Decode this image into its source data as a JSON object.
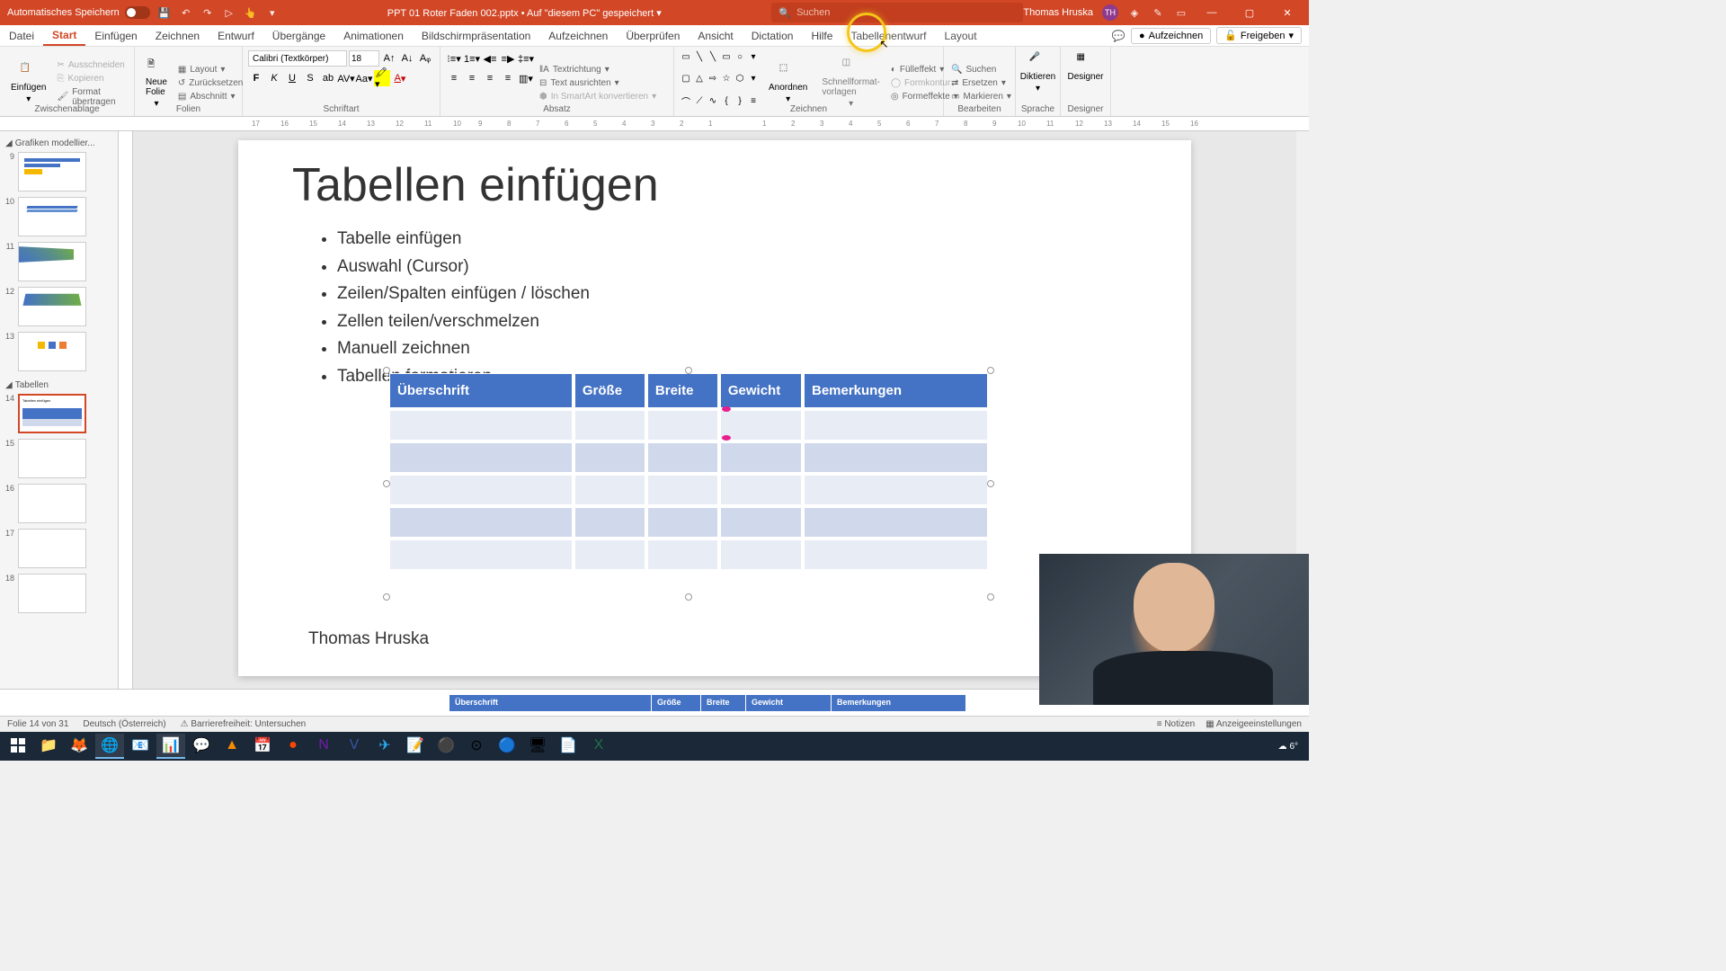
{
  "titlebar": {
    "autosave": "Automatisches Speichern",
    "filename": "PPT 01 Roter Faden 002.pptx",
    "saved_status": "Auf \"diesem PC\" gespeichert",
    "search_placeholder": "Suchen",
    "user_name": "Thomas Hruska",
    "user_initials": "TH"
  },
  "tabs": {
    "datei": "Datei",
    "start": "Start",
    "einfuegen": "Einfügen",
    "zeichnen": "Zeichnen",
    "entwurf": "Entwurf",
    "uebergaenge": "Übergänge",
    "animationen": "Animationen",
    "bildschirm": "Bildschirmpräsentation",
    "aufzeichnen": "Aufzeichnen",
    "ueberpruefen": "Überprüfen",
    "ansicht": "Ansicht",
    "dictation": "Dictation",
    "hilfe": "Hilfe",
    "tabellenentwurf": "Tabellenentwurf",
    "layout": "Layout",
    "rec_btn": "Aufzeichnen",
    "share_btn": "Freigeben"
  },
  "ribbon": {
    "clipboard": {
      "label": "Zwischenablage",
      "paste": "Einfügen",
      "cut": "Ausschneiden",
      "copy": "Kopieren",
      "format": "Format übertragen"
    },
    "slides": {
      "label": "Folien",
      "new": "Neue Folie",
      "layout": "Layout",
      "reset": "Zurücksetzen",
      "section": "Abschnitt"
    },
    "font": {
      "label": "Schriftart",
      "name": "Calibri (Textkörper)",
      "size": "18"
    },
    "paragraph": {
      "label": "Absatz",
      "textrichtung": "Textrichtung",
      "ausrichten": "Text ausrichten",
      "smartart": "In SmartArt konvertieren"
    },
    "drawing": {
      "label": "Zeichnen",
      "anordnen": "Anordnen",
      "schnellformat": "Schnellformat-vorlagen",
      "fuell": "Fülleffekt",
      "kontur": "Formkontur",
      "effekte": "Formeffekte"
    },
    "editing": {
      "label": "Bearbeiten",
      "suchen": "Suchen",
      "ersetzen": "Ersetzen",
      "markieren": "Markieren"
    },
    "voice": {
      "label": "Sprache",
      "diktieren": "Diktieren"
    },
    "designer": {
      "label": "Designer",
      "btn": "Designer"
    }
  },
  "sections": {
    "grafiken": "Grafiken modellier...",
    "tabellen": "Tabellen"
  },
  "thumbs": [
    "9",
    "10",
    "11",
    "12",
    "13",
    "14",
    "15",
    "16",
    "17",
    "18"
  ],
  "slide": {
    "title": "Tabellen einfügen",
    "bullets": [
      "Tabelle einfügen",
      "Auswahl (Cursor)",
      "Zeilen/Spalten einfügen / löschen",
      "Zellen teilen/verschmelzen",
      "Manuell zeichnen",
      "Tabellen formatieren"
    ],
    "table_headers": [
      "Überschrift",
      "Größe",
      "Breite",
      "Gewicht",
      "Bemerkungen"
    ],
    "footer": "Thomas Hruska"
  },
  "statusbar": {
    "slide_info": "Folie 14 von 31",
    "language": "Deutsch (Österreich)",
    "accessibility": "Barrierefreiheit: Untersuchen",
    "notes": "Notizen",
    "display": "Anzeigeeinstellungen"
  },
  "taskbar": {
    "temp": "6°"
  }
}
